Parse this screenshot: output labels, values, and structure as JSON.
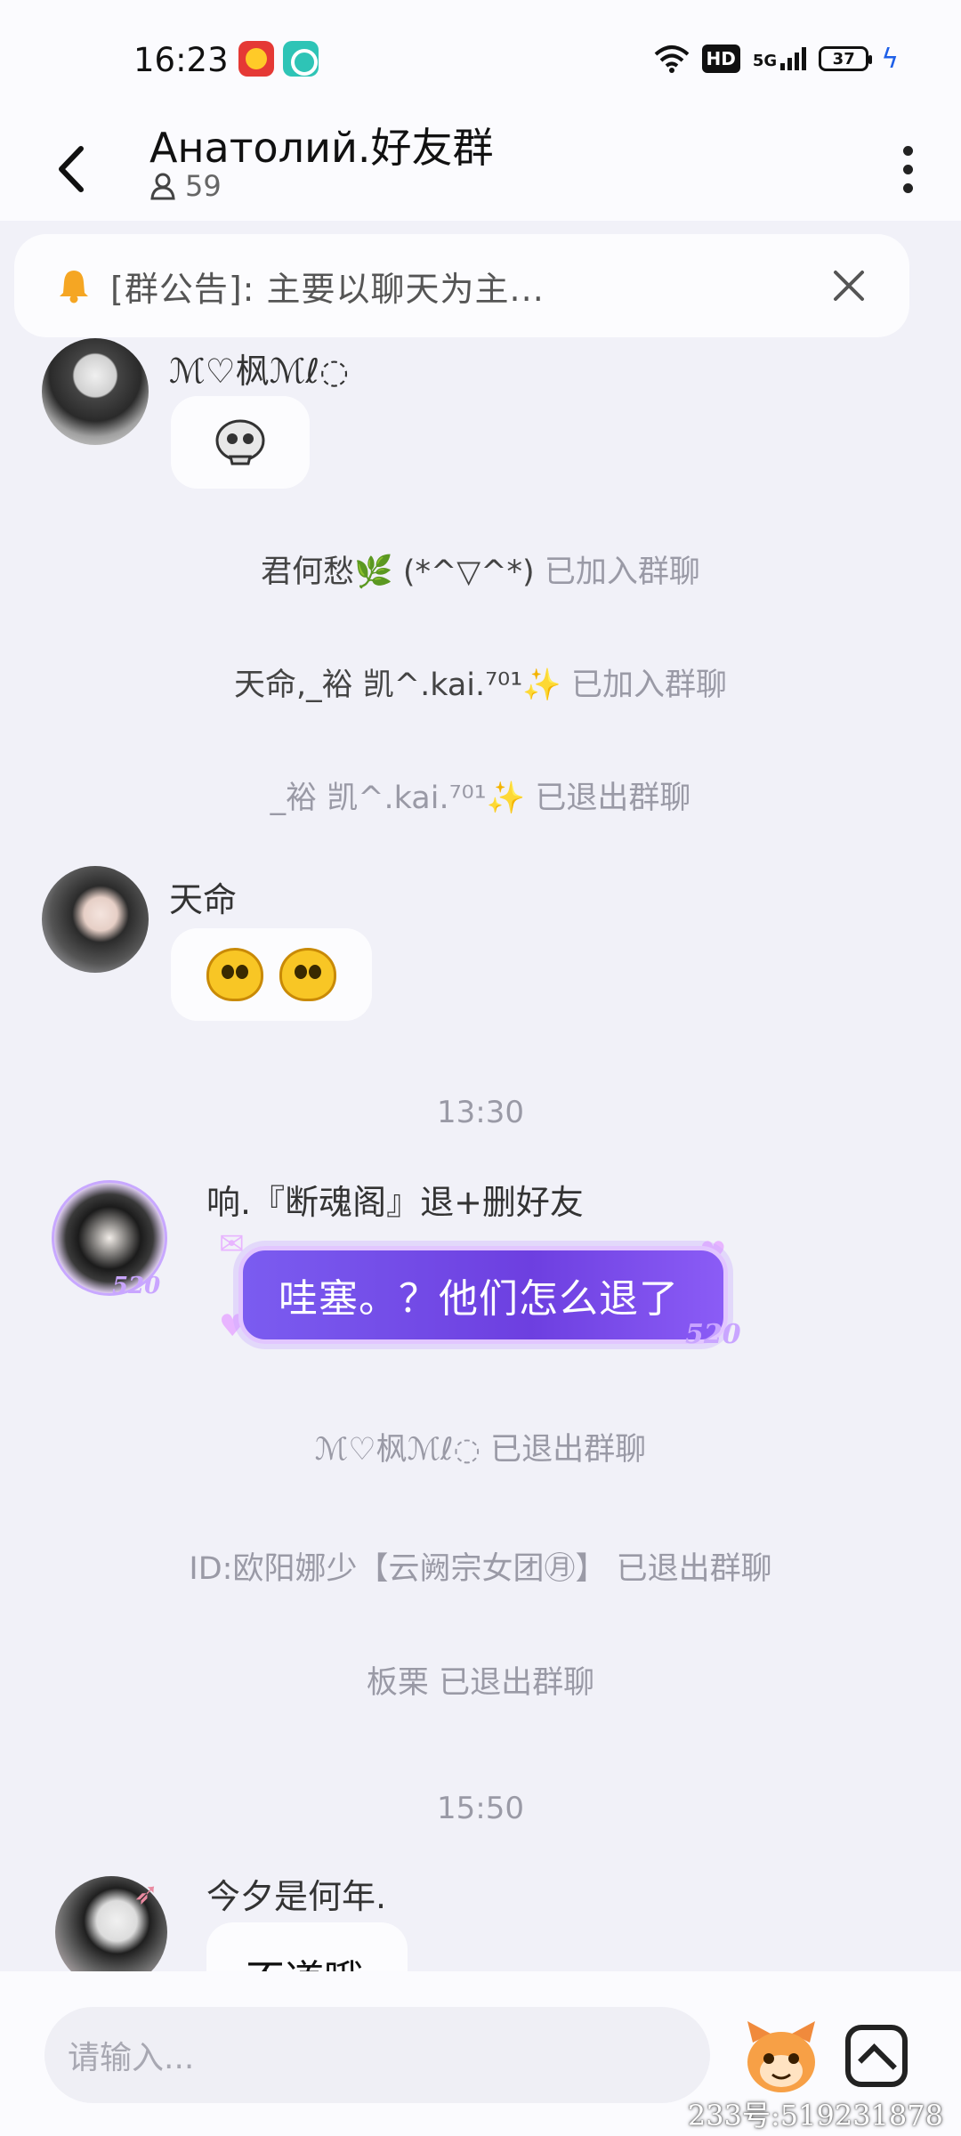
{
  "status_bar": {
    "time": "16:23",
    "network": "5G",
    "hd": "HD",
    "battery": "37"
  },
  "header": {
    "title": "Анатолий.好友群",
    "member_count": "59"
  },
  "notice": {
    "text": "[群公告]: 主要以聊天为主..."
  },
  "messages": [
    {
      "sender": "ℳ♡枫ℳℓ◌"
    },
    {
      "sender": "天命"
    },
    {
      "sender": "响.『断魂阁』退+删好友",
      "text": "哇塞。？他们怎么退了",
      "badge": "520"
    },
    {
      "sender": "今夕是何年.",
      "text": "不道哦"
    }
  ],
  "system_messages": [
    {
      "name": "君何愁🌿 (*^▽^*)",
      "action": "已加入群聊"
    },
    {
      "name": "天命,_裕 凯^.kai.⁷⁰¹✨",
      "action": "已加入群聊"
    },
    {
      "name": "_裕 凯^.kai.⁷⁰¹✨",
      "action": "已退出群聊"
    },
    {
      "name": "ℳ♡枫ℳℓ◌",
      "action": "已退出群聊"
    },
    {
      "name": "ID:欧阳娜少【云阙宗女团㊊】",
      "action": "已退出群聊"
    },
    {
      "name": "板栗",
      "action": "已退出群聊"
    }
  ],
  "timestamps": [
    "13:30",
    "15:50"
  ],
  "input": {
    "placeholder": "请输入..."
  },
  "watermark": "233号:519231878",
  "colors": {
    "accent": "#7b5cf0",
    "background": "#f1f1f8",
    "system_text": "#9a9aa6",
    "charging": "#1e5fe8"
  }
}
